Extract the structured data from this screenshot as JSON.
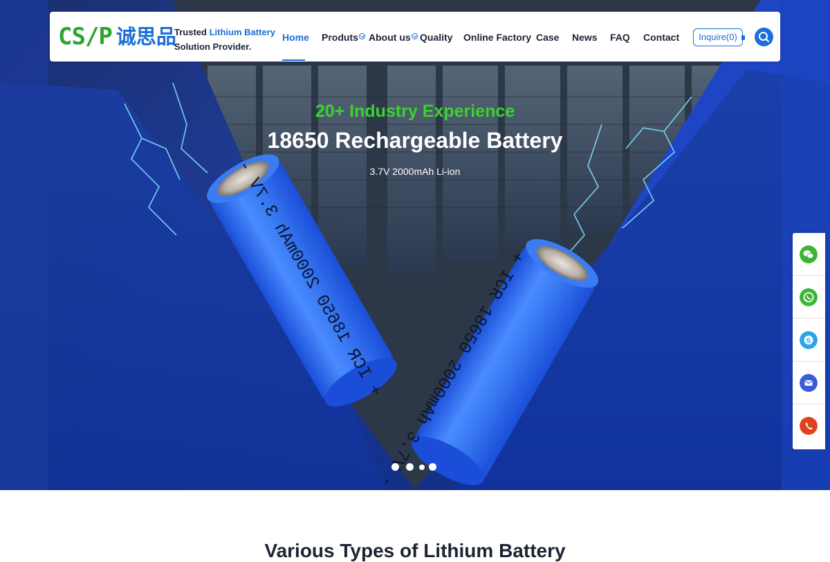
{
  "header": {
    "logo_en": "CS/P",
    "logo_cn": "诚思品",
    "tagline_prefix": "Trusted ",
    "tagline_highlight": "Lithium Battery",
    "tagline_line2": "Solution Provider.",
    "nav": [
      "Home",
      "Produts",
      "About us",
      "Quality",
      "Online Factory",
      "Case",
      "News",
      "FAQ",
      "Contact"
    ],
    "active_nav": "Home",
    "inquire_label": "Inquire(0)"
  },
  "hero": {
    "kicker": "20+ Industry Experience",
    "title": "18650 Rechargeable Battery",
    "subtitle": "3.7V 2000mAh Li-ion",
    "battery_label": "+ ICR 18650 2000mAh 3.7V -",
    "slide_count": 4,
    "active_slide": 2,
    "colors": {
      "kicker": "#3bd22f",
      "accent": "#1b6fd8"
    }
  },
  "side_contacts": [
    {
      "icon": "wechat-icon",
      "color": "#3cb531"
    },
    {
      "icon": "whatsapp-icon",
      "color": "#3cb531"
    },
    {
      "icon": "skype-icon",
      "color": "#2aa5ea"
    },
    {
      "icon": "email-icon",
      "color": "#3b5bd8"
    },
    {
      "icon": "phone-icon",
      "color": "#e0431c"
    }
  ],
  "section": {
    "title": "Various Types of Lithium Battery"
  }
}
